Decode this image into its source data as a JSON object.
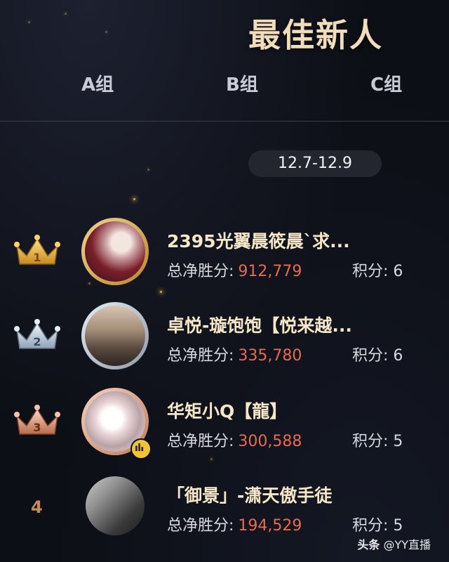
{
  "header": {
    "title": "最佳新人"
  },
  "tabs": [
    {
      "label": "A组"
    },
    {
      "label": "B组"
    },
    {
      "label": "C组"
    }
  ],
  "date_range": "12.7-12.9",
  "ranking": [
    {
      "rank": 1,
      "name": "2395光翼晨筱晨`求...",
      "net_win_label": "总净胜分:",
      "net_win_value": "912,779",
      "points_label": "积分:",
      "points_value": "6"
    },
    {
      "rank": 2,
      "name": "卓悦-璇饱饱【悦来越...",
      "net_win_label": "总净胜分:",
      "net_win_value": "335,780",
      "points_label": "积分:",
      "points_value": "6"
    },
    {
      "rank": 3,
      "name": "华矩小Q【龍】",
      "net_win_label": "总净胜分:",
      "net_win_value": "300,588",
      "points_label": "积分:",
      "points_value": "5"
    },
    {
      "rank": 4,
      "name": "「御景」-潇天傲手徒",
      "net_win_label": "总净胜分:",
      "net_win_value": "194,529",
      "points_label": "积分:",
      "points_value": "5"
    }
  ],
  "rank_text": {
    "four": "4"
  },
  "watermark": {
    "platform": "头条",
    "account": "@YY直播"
  },
  "colors": {
    "accent_value": "#e86a52",
    "title": "#f1dcbb",
    "gold": "#d7a64a"
  },
  "icons": {
    "crown_gold": "crown-icon",
    "crown_silver": "crown-icon",
    "crown_bronze": "crown-icon",
    "live": "live-bars-icon"
  }
}
